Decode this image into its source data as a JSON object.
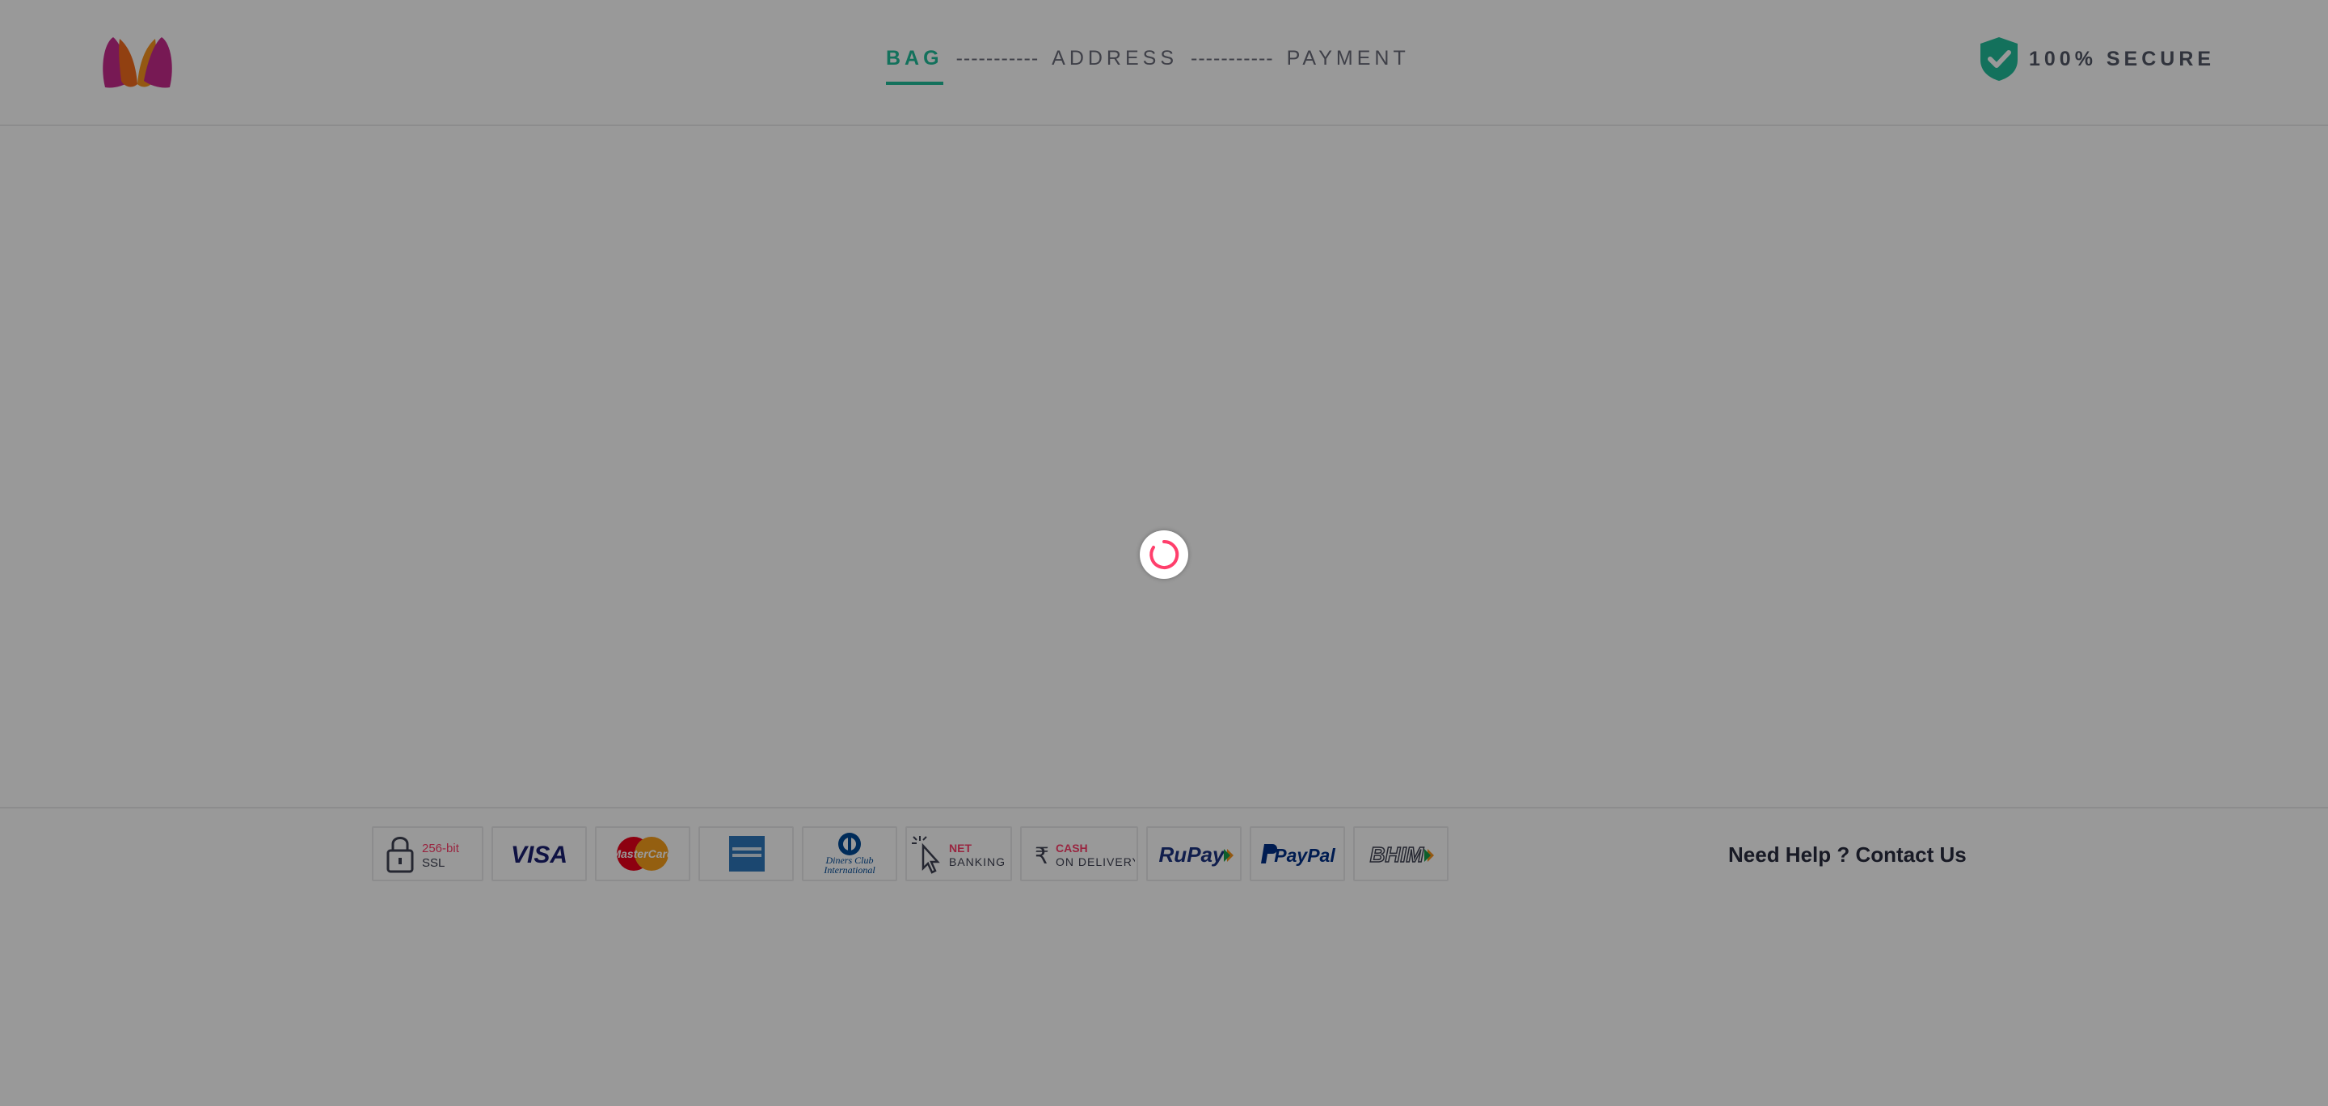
{
  "header": {
    "logo_icon": "myntra-logo-icon",
    "steps": [
      {
        "label": "BAG",
        "active": true
      },
      {
        "label": "ADDRESS",
        "active": false
      },
      {
        "label": "PAYMENT",
        "active": false
      }
    ],
    "separator": "-----------",
    "secure_label": "100% SECURE",
    "secure_icon": "shield-check-icon"
  },
  "loading": {
    "icon": "spinner-icon"
  },
  "footer": {
    "payment_methods": {
      "ssl": {
        "line1": "256-bit",
        "line2": "SSL"
      },
      "visa": "VISA",
      "mastercard": "MasterCard",
      "amex": "amex-icon",
      "diners": {
        "line1": "Diners Club",
        "line2": "International"
      },
      "netbanking": {
        "line1": "NET",
        "line2": "BANKING"
      },
      "cod": {
        "line1": "CASH",
        "line2": "ON DELIVERY"
      },
      "rupay": "RuPay",
      "paypal": "PayPal",
      "bhim": "BHIM"
    },
    "help_text": "Need Help ? Contact Us"
  },
  "colors": {
    "accent": "#20bd99",
    "brand": "#ff3f6c",
    "overlay": "rgba(0,0,0,0.4)"
  }
}
